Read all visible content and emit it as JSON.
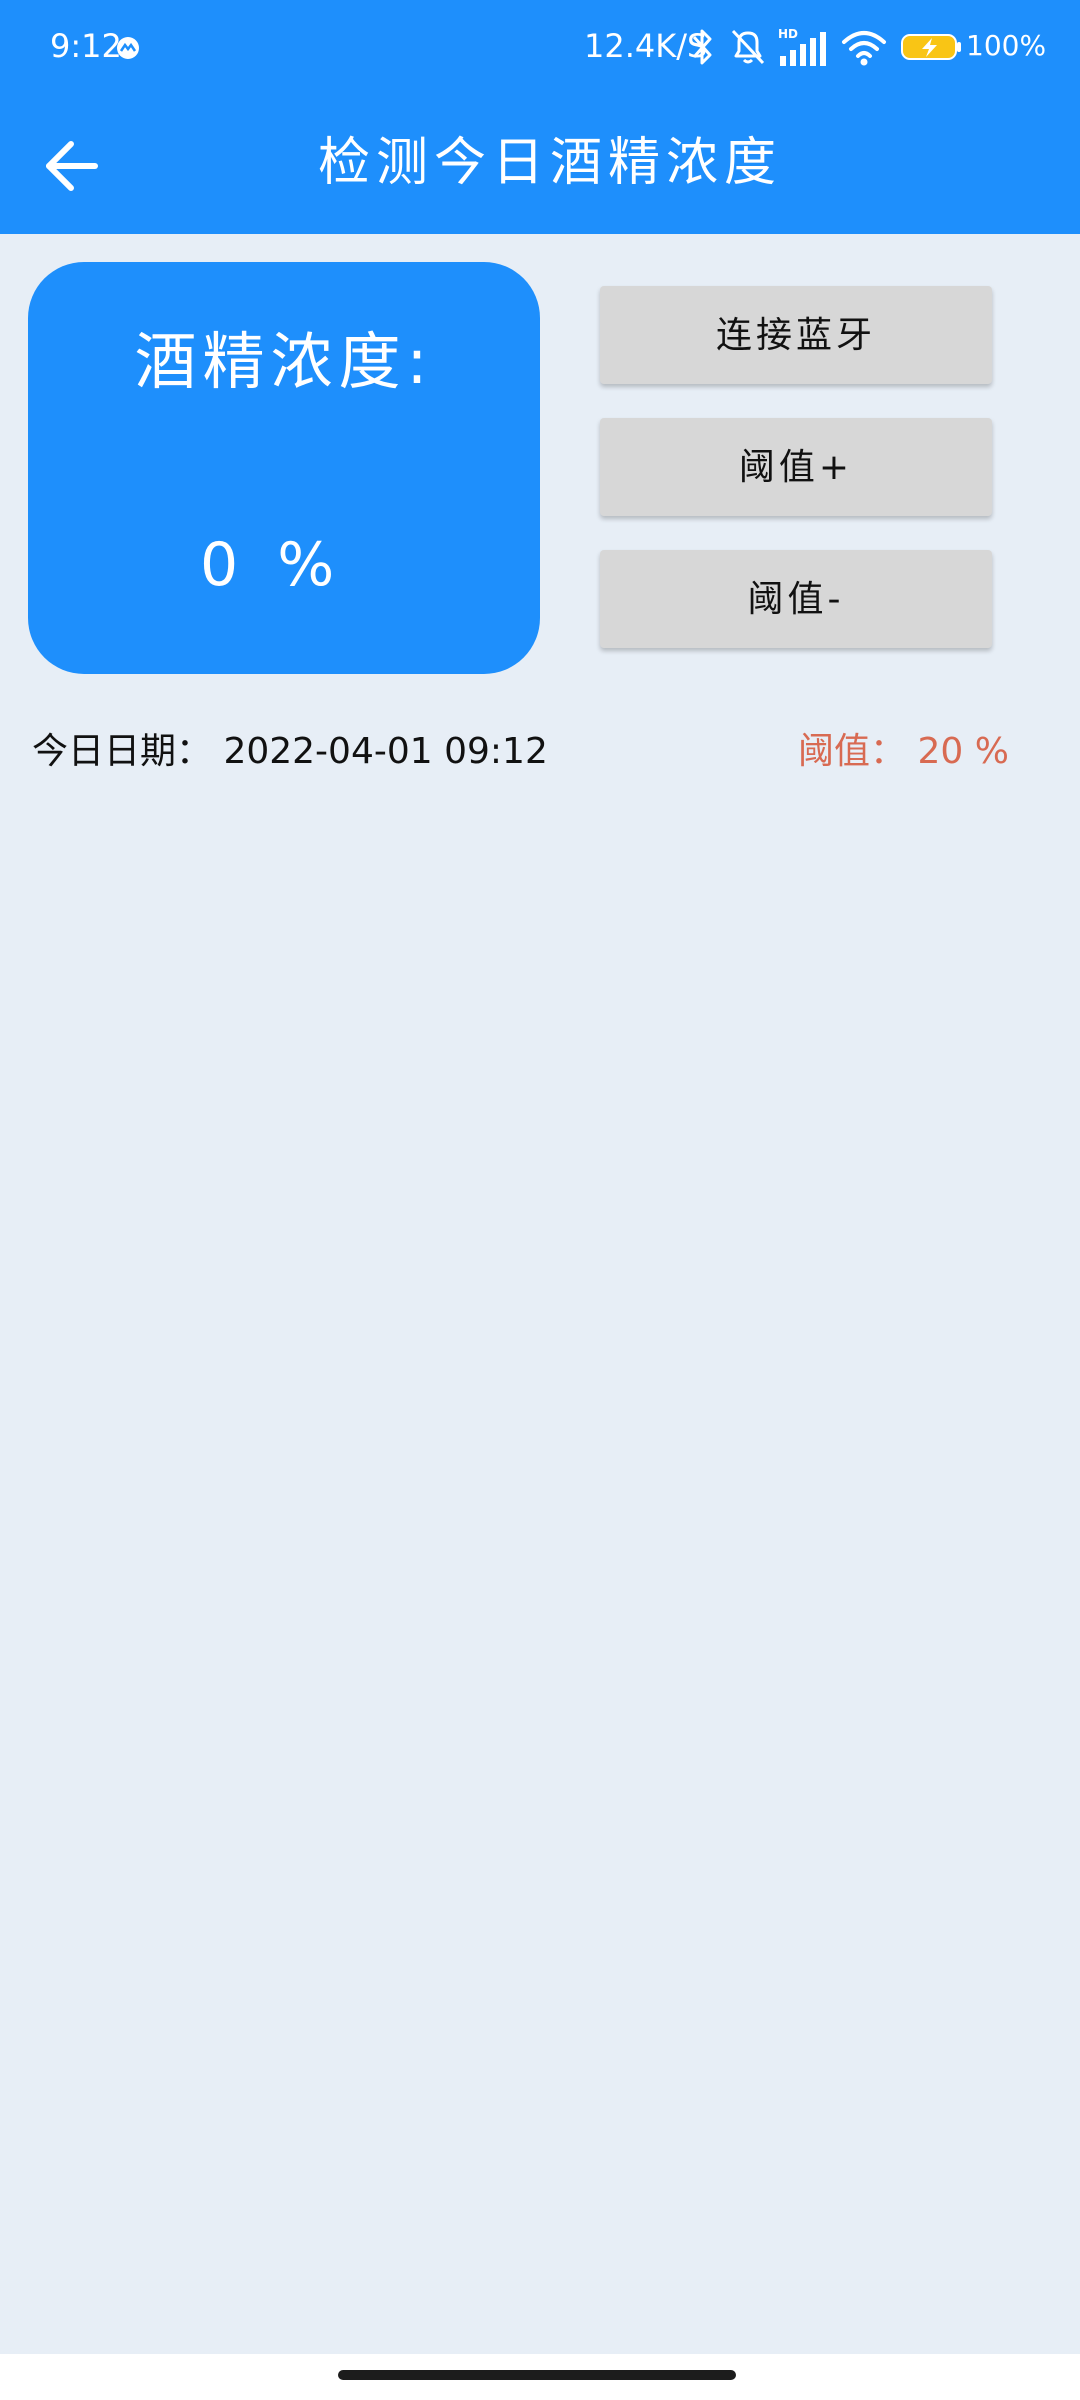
{
  "status_bar": {
    "time": "9:12",
    "network_speed": "12.4K/S",
    "battery_percent": "100%",
    "icons": [
      "app-notification-icon",
      "bluetooth-icon",
      "mute-bell-icon",
      "hd-signal-icon",
      "wifi-icon",
      "battery-charging-icon"
    ]
  },
  "app_bar": {
    "title": "检测今日酒精浓度",
    "back_icon": "arrow-left-icon"
  },
  "concentration": {
    "label": "酒精浓度:",
    "value": "0 %"
  },
  "buttons": {
    "connect": "连接蓝牙",
    "threshold_plus": "阈值+",
    "threshold_minus": "阈值-"
  },
  "info": {
    "date": "今日日期： 2022-04-01 09:12",
    "threshold": "阈值： 20 %"
  },
  "colors": {
    "primary": "#1e8ffc",
    "background": "#e7eef6",
    "button": "#d7d7d7",
    "threshold_text": "#d86a52"
  }
}
